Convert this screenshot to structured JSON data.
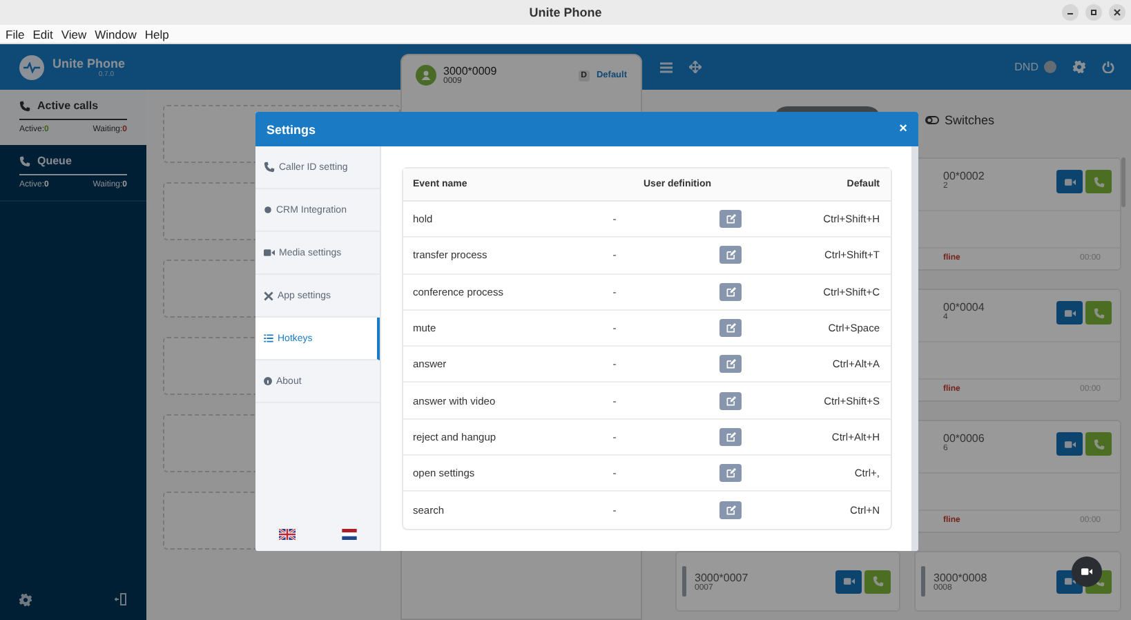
{
  "window": {
    "title": "Unite Phone"
  },
  "menu": [
    "File",
    "Edit",
    "View",
    "Window",
    "Help"
  ],
  "app": {
    "name": "Unite Phone",
    "version": "0.7.0"
  },
  "sidebar": {
    "sections": [
      {
        "title": "Active calls",
        "selected": true,
        "active_label": "Active:",
        "active_value": "0",
        "waiting_label": "Waiting:",
        "waiting_value": "0"
      },
      {
        "title": "Queue",
        "selected": false,
        "active_label": "Active:",
        "active_value": "0",
        "waiting_label": "Waiting:",
        "waiting_value": "0"
      }
    ]
  },
  "account": {
    "number": "3000*0009",
    "extension": "0009",
    "badge": "D",
    "profile": "Default"
  },
  "dnd": {
    "label": "DND",
    "on": false
  },
  "switches_label": "Switches",
  "contacts": [
    {
      "number": "00*0002",
      "extension": "2",
      "status": "fline",
      "time": "00:00"
    },
    {
      "number": "00*0004",
      "extension": "4",
      "status": "fline",
      "time": "00:00"
    },
    {
      "number": "00*0006",
      "extension": "6",
      "status": "fline",
      "time": "00:00"
    }
  ],
  "bottom_contacts": [
    {
      "number": "3000*0007",
      "extension": "0007"
    },
    {
      "number": "3000*0008",
      "extension": "0008"
    }
  ],
  "settings": {
    "title": "Settings",
    "close": "×",
    "nav": [
      {
        "label": "Caller ID setting",
        "selected": false
      },
      {
        "label": "CRM Integration",
        "selected": false
      },
      {
        "label": "Media settings",
        "selected": false
      },
      {
        "label": "App settings",
        "selected": false
      },
      {
        "label": "Hotkeys",
        "selected": true
      },
      {
        "label": "About",
        "selected": false
      }
    ],
    "languages": [
      {
        "kind": "uk"
      },
      {
        "kind": "nl"
      }
    ],
    "columns": [
      "Event name",
      "User definition",
      "Default"
    ],
    "rows": [
      {
        "event": "hold",
        "user": "-",
        "default": "Ctrl+Shift+H"
      },
      {
        "event": "transfer process",
        "user": "-",
        "default": "Ctrl+Shift+T"
      },
      {
        "event": "conference process",
        "user": "-",
        "default": "Ctrl+Shift+C"
      },
      {
        "event": "mute",
        "user": "-",
        "default": "Ctrl+Space"
      },
      {
        "event": "answer",
        "user": "-",
        "default": "Ctrl+Alt+A"
      },
      {
        "event": "answer with video",
        "user": "-",
        "default": "Ctrl+Shift+S"
      },
      {
        "event": "reject and hangup",
        "user": "-",
        "default": "Ctrl+Alt+H"
      },
      {
        "event": "open settings",
        "user": "-",
        "default": "Ctrl+,"
      },
      {
        "event": "search",
        "user": "-",
        "default": "Ctrl+N"
      }
    ]
  }
}
